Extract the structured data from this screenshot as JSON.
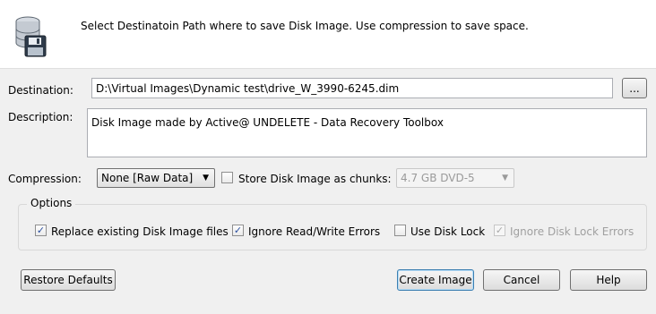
{
  "header": {
    "instruction": "Select Destinatoin Path where to save Disk Image. Use compression to save space.",
    "icon": "database-floppy-icon"
  },
  "destination": {
    "label": "Destination:",
    "value": "D:\\Virtual Images\\Dynamic test\\drive_W_3990-6245.dim",
    "browse_label": "..."
  },
  "description": {
    "label": "Description:",
    "value": "Disk Image made by Active@ UNDELETE - Data Recovery Toolbox"
  },
  "compression": {
    "label": "Compression:",
    "selected": "None [Raw Data]",
    "chunks_label": "Store Disk Image as chunks:",
    "chunks_checked": false,
    "chunk_size": "4.7 GB DVD-5"
  },
  "options": {
    "title": "Options",
    "items": [
      {
        "label": "Replace existing Disk Image files",
        "checked": true,
        "enabled": true
      },
      {
        "label": "Ignore Read/Write Errors",
        "checked": true,
        "enabled": true
      },
      {
        "label": "Use Disk Lock",
        "checked": false,
        "enabled": true
      },
      {
        "label": "Ignore Disk Lock Errors",
        "checked": true,
        "enabled": false
      }
    ]
  },
  "buttons": {
    "restore_defaults": "Restore Defaults",
    "create_image": "Create Image",
    "cancel": "Cancel",
    "help": "Help"
  },
  "colors": {
    "background": "#f0f0f0",
    "header_background": "#ffffff",
    "default_button_border": "#3c7fb1",
    "check_color": "#2a4f9e"
  }
}
